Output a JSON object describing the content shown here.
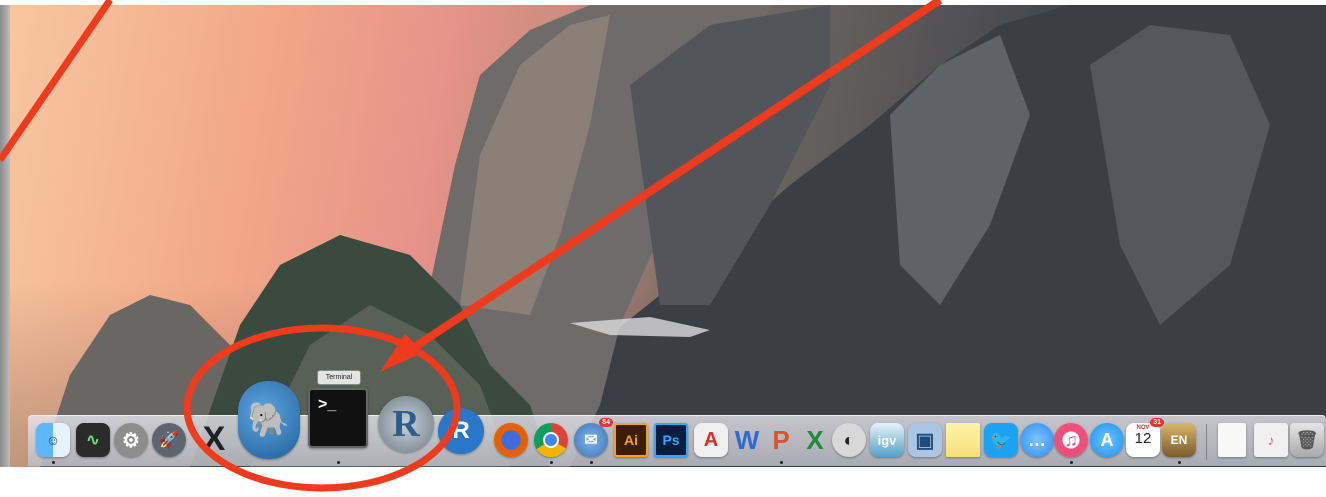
{
  "tooltip": {
    "text": "Terminal"
  },
  "calendar": {
    "month": "NOV",
    "day": "12",
    "badge_day": "31"
  },
  "mail_badge": "84",
  "dock": {
    "items": [
      {
        "name": "finder",
        "glyph": "☺",
        "color": "#2a8df5"
      },
      {
        "name": "activity-monitor",
        "glyph": "∿",
        "color": "#2b2b2b"
      },
      {
        "name": "system-preferences",
        "glyph": "⚙",
        "color": "#8d8d8d"
      },
      {
        "name": "launchpad",
        "glyph": "🚀",
        "color": "#5c6570"
      },
      {
        "name": "x11",
        "glyph": "X",
        "color": "#333333"
      },
      {
        "name": "postgres",
        "glyph": "🐘",
        "color": "#336a9e"
      },
      {
        "name": "terminal",
        "glyph": ">_",
        "color": "#111111"
      },
      {
        "name": "r",
        "glyph": "R",
        "color": "#6d7b86"
      },
      {
        "name": "rstudio",
        "glyph": "R",
        "color": "#2a76c8"
      },
      {
        "name": "firefox",
        "glyph": "◉",
        "color": "#e66000"
      },
      {
        "name": "chrome",
        "glyph": "●",
        "color": "#2f9e44"
      },
      {
        "name": "thunderbird",
        "glyph": "✉",
        "color": "#3c6fb0"
      },
      {
        "name": "illustrator",
        "glyph": "Ai",
        "color": "#3b1e05"
      },
      {
        "name": "photoshop",
        "glyph": "Ps",
        "color": "#0b1d3c"
      },
      {
        "name": "acrobat",
        "glyph": "A",
        "color": "#e8e8e8"
      },
      {
        "name": "word",
        "glyph": "W",
        "color": "#2c6bd3"
      },
      {
        "name": "powerpoint",
        "glyph": "P",
        "color": "#d9542c"
      },
      {
        "name": "excel",
        "glyph": "X",
        "color": "#1f8a3a"
      },
      {
        "name": "cyberduck",
        "glyph": "◐",
        "color": "#b8b8b8"
      },
      {
        "name": "igv",
        "glyph": "igv",
        "color": "#55a0c8"
      },
      {
        "name": "virtualbox",
        "glyph": "▣",
        "color": "#4a7fb5"
      },
      {
        "name": "stickies",
        "glyph": "",
        "color": "#f7e07a"
      },
      {
        "name": "twitter",
        "glyph": "🐦",
        "color": "#1da1f2"
      },
      {
        "name": "messages",
        "glyph": "…",
        "color": "#2f8cf0"
      },
      {
        "name": "itunes",
        "glyph": "♫",
        "color": "#f04f7b"
      },
      {
        "name": "app-store",
        "glyph": "A",
        "color": "#1c8ef0"
      },
      {
        "name": "calendar",
        "glyph": "12",
        "color": "#ffffff"
      },
      {
        "name": "dictionary",
        "glyph": "EN",
        "color": "#7a5b2e"
      },
      {
        "name": "document",
        "glyph": "",
        "color": "#f5f5f5"
      },
      {
        "name": "downloads-stack",
        "glyph": "♪",
        "color": "#e6e6e6"
      },
      {
        "name": "trash",
        "glyph": "🗑",
        "color": "#c9c9c9"
      }
    ]
  }
}
